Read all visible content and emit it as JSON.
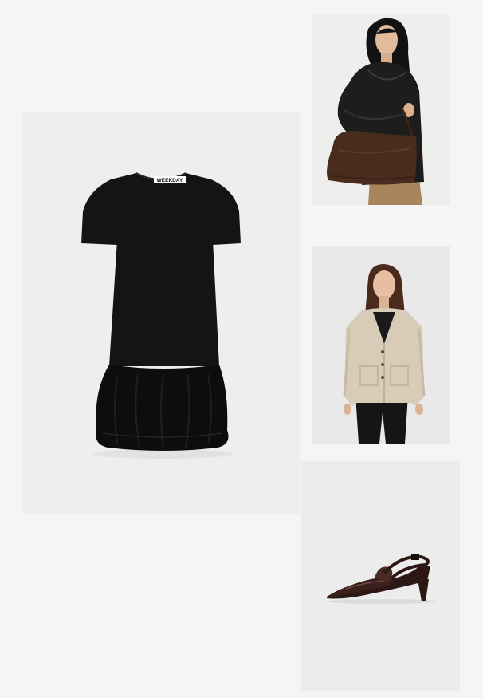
{
  "outfit": {
    "items": [
      {
        "id": "dress",
        "image": "black-tshirt-dress-with-bubble-hem",
        "brand_label": "WEEKDAY",
        "background": "#eeeeee"
      },
      {
        "id": "bag",
        "image": "model-carrying-brown-suede-shoulder-bag",
        "background": "#eeeeec"
      },
      {
        "id": "cardigan",
        "image": "model-wearing-beige-knit-cardigan",
        "background": "#e9e9e9"
      },
      {
        "id": "shoe",
        "image": "dark-brown-patent-slingback-kitten-heel",
        "background": "#ececec"
      }
    ]
  }
}
